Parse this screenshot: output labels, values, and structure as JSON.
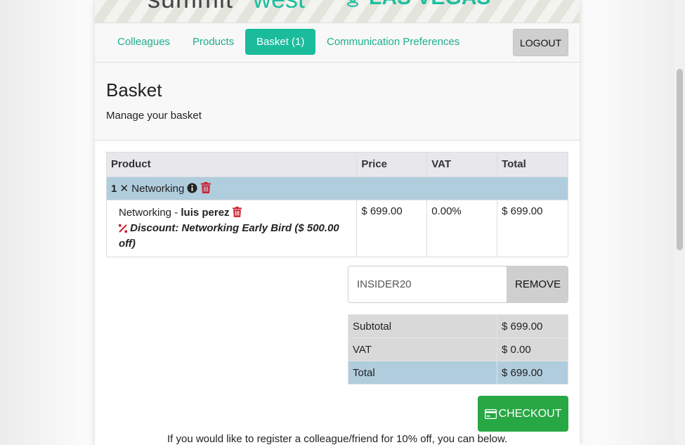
{
  "banner": {
    "logo_part1": "summit",
    "logo_part2": "west",
    "logo_location": "LAS VEGAS"
  },
  "nav": {
    "items": [
      {
        "label": "Colleagues",
        "active": false
      },
      {
        "label": "Products",
        "active": false
      },
      {
        "label": "Basket (1)",
        "active": true
      },
      {
        "label": "Communication Preferences",
        "active": false
      }
    ],
    "logout_label": "LOGOUT"
  },
  "header": {
    "title": "Basket",
    "subtitle": "Manage your basket"
  },
  "cart": {
    "columns": [
      "Product",
      "Price",
      "VAT",
      "Total"
    ],
    "group": {
      "qty": "1",
      "times": "✕",
      "name": "Networking"
    },
    "item": {
      "name": "Networking - ",
      "attendee": "luis perez",
      "discount": "Discount: Networking Early Bird ($ 500.00 off)",
      "price": "$ 699.00",
      "vat": "0.00%",
      "total": "$ 699.00"
    }
  },
  "coupon": {
    "value": "INSIDER20",
    "remove_label": "REMOVE"
  },
  "totals": {
    "subtotal_label": "Subtotal",
    "subtotal_value": "$ 699.00",
    "vat_label": "VAT",
    "vat_value": "$ 0.00",
    "total_label": "Total",
    "total_value": "$ 699.00"
  },
  "checkout_label": "CHECKOUT",
  "footer_note": "If you would like to register a colleague/friend for 10% off, you can below.",
  "colors": {
    "accent": "#1abc9c",
    "checkout": "#28a745",
    "danger": "#c82333",
    "row_highlight": "#b0cddd"
  }
}
